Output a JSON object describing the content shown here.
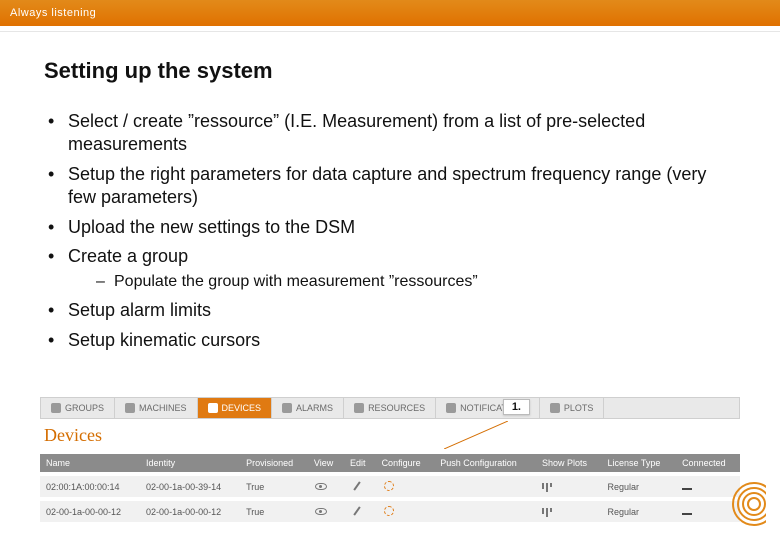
{
  "banner": {
    "tagline": "Always listening"
  },
  "title": "Setting up the system",
  "bullets": [
    "Select / create ”ressource” (I.E. Measurement) from a list of pre-selected measurements",
    "Setup the right parameters for data capture and spectrum frequency range (very few parameters)",
    "Upload the new settings to the DSM",
    "Create a group"
  ],
  "subbullet": "Populate the group with measurement ”ressources”",
  "bullets2": [
    "Setup alarm limits",
    "Setup kinematic cursors"
  ],
  "app": {
    "tabs": [
      "GROUPS",
      "MACHINES",
      "DEVICES",
      "ALARMS",
      "RESOURCES",
      "NOTIFICATIONS",
      "PLOTS"
    ],
    "activeTab": "DEVICES",
    "panelTitle": "Devices",
    "callout": "1.",
    "columns": [
      "Name",
      "Identity",
      "Provisioned",
      "View",
      "Edit",
      "Configure",
      "Push Configuration",
      "Show Plots",
      "License Type",
      "Connected"
    ],
    "rows": [
      {
        "name": "02:00:1A:00:00:14",
        "identity": "02-00-1a-00-39-14",
        "provisioned": "True",
        "license": "Regular"
      },
      {
        "name": "02-00-1a-00-00-12",
        "identity": "02-00-1a-00-00-12",
        "provisioned": "True",
        "license": "Regular"
      }
    ]
  }
}
